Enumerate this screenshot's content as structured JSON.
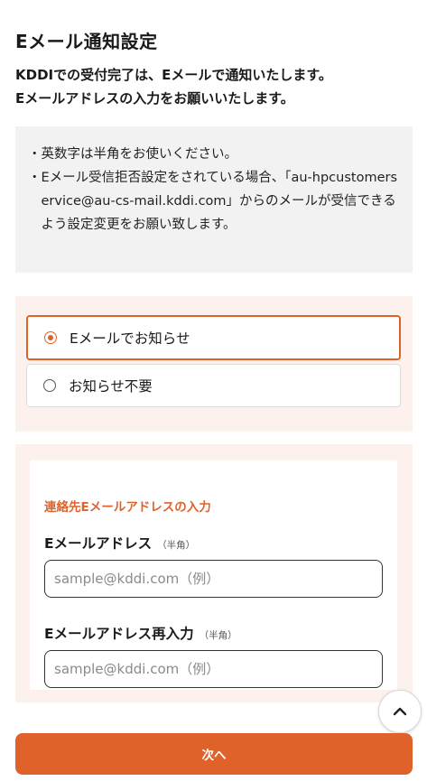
{
  "page": {
    "title": "Eメール通知設定",
    "lead_line1": "KDDIでの受付完了は、Eメールで通知いたします。",
    "lead_line2": "Eメールアドレスの入力をお願いいたします。"
  },
  "notes": {
    "bullet": "・",
    "items": [
      "英数字は半角をお使いください。",
      "Eメール受信拒否設定をされている場合、「au-hpcustomerservice@au-cs-mail.kddi.com」からのメールが受信できるよう設定変更をお願い致します。"
    ]
  },
  "notification_choice": {
    "options": [
      {
        "label": "Eメールでお知らせ",
        "selected": true
      },
      {
        "label": "お知らせ不要",
        "selected": false
      }
    ]
  },
  "email_section": {
    "section_label": "連絡先Eメールアドレスの入力",
    "email": {
      "label": "Eメールアドレス",
      "hint": "（半角）",
      "placeholder": "sample@kddi.com（例）",
      "value": ""
    },
    "email_confirm": {
      "label": "Eメールアドレス再入力",
      "hint": "（半角）",
      "placeholder": "sample@kddi.com（例）",
      "value": ""
    }
  },
  "actions": {
    "scroll_top_icon": "chevron-up-icon",
    "next_label": "次へ"
  },
  "colors": {
    "accent": "#e0622b",
    "panel_bg": "#fcf1ec",
    "notes_bg": "#f2f2f2"
  }
}
